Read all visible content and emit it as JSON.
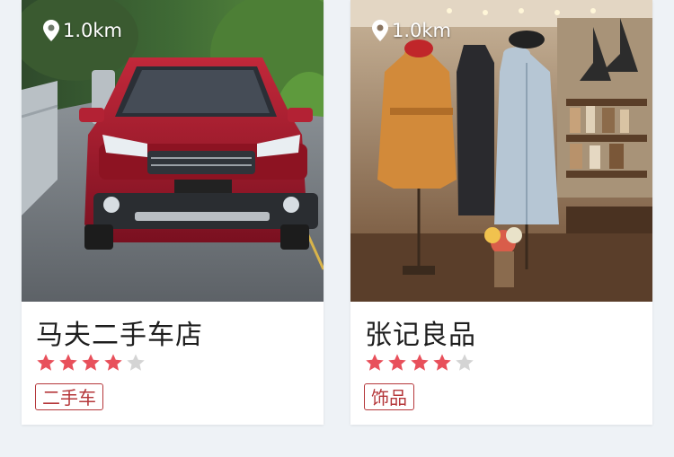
{
  "colors": {
    "background": "#eef2f6",
    "card": "#ffffff",
    "star_filled": "#e8505b",
    "star_empty": "#d4d4d4",
    "tag": "#b5373a",
    "title": "#1e1e1e"
  },
  "stores": [
    {
      "name": "马夫二手车店",
      "distance": "1.0km",
      "rating": 4,
      "rating_max": 5,
      "tag": "二手车",
      "photo": "red-suv-on-road"
    },
    {
      "name": "张记良品",
      "distance": "1.0km",
      "rating": 4,
      "rating_max": 5,
      "tag": "饰品",
      "photo": "clothing-boutique-interior"
    }
  ]
}
